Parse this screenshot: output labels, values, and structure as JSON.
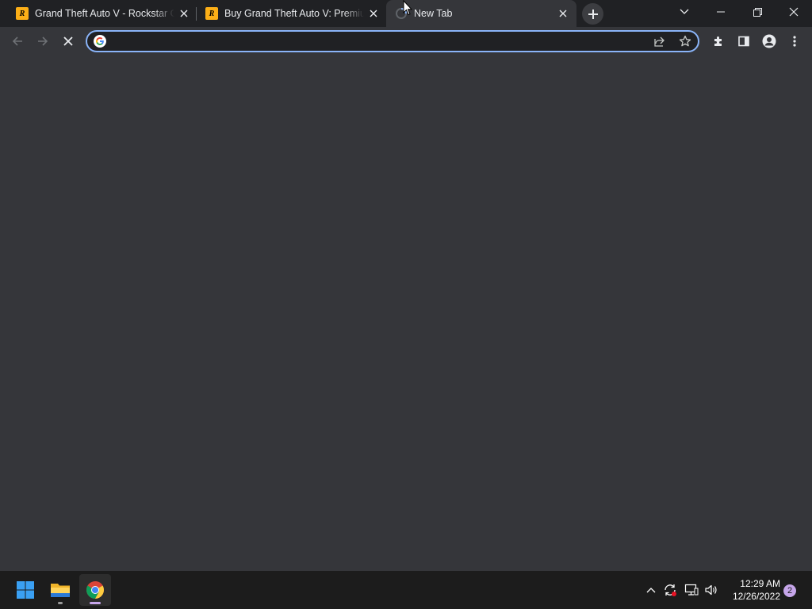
{
  "tabs": [
    {
      "title": "Grand Theft Auto V - Rockstar Games",
      "icon": "rockstar-logo",
      "active": false
    },
    {
      "title": "Buy Grand Theft Auto V: Premium Edition",
      "icon": "rockstar-logo",
      "active": false
    },
    {
      "title": "New Tab",
      "icon": "loading-spinner",
      "active": true
    }
  ],
  "rockstar_logo_text": "R",
  "omnibox": {
    "value": "",
    "placeholder": ""
  },
  "taskbar": {
    "time": "12:29 AM",
    "date": "12/26/2022",
    "notification_count": "2",
    "apps": [
      "windows-start",
      "file-explorer",
      "google-chrome"
    ]
  },
  "colors": {
    "tabstrip_bg": "#202124",
    "toolbar_bg": "#35363a",
    "accent_focus": "#8ab4f8",
    "rockstar_yellow": "#fcaf17",
    "taskbar_bg": "#1c1c1c"
  }
}
